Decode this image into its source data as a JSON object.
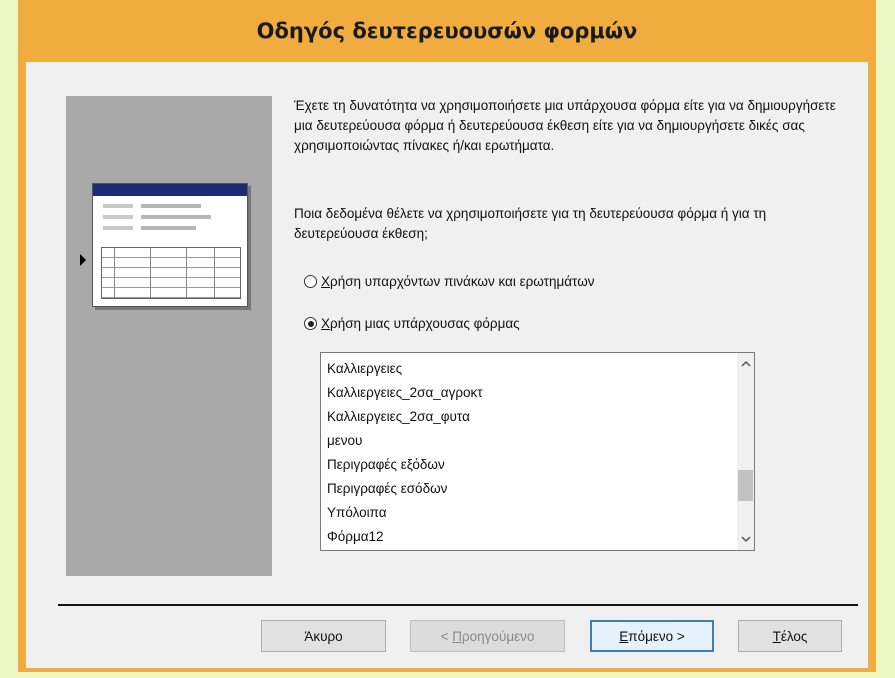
{
  "window": {
    "title": "Οδηγός δευτερευουσών φορμών"
  },
  "intro_text": "Έχετε τη δυνατότητα να χρησιμοποιήσετε μια υπάρχουσα φόρμα είτε για να δημιουργήσετε μια δευτερεύουσα φόρμα ή δευτερεύουσα έκθεση είτε για να δημιουργήσετε δικές σας χρησιμοποιώντας πίνακες ή/και ερωτήματα.",
  "question_text": "Ποια δεδομένα θέλετε να χρησιμοποιήσετε για τη δευτερεύουσα φόρμα ή για τη δευτερεύουσα έκθεση;",
  "options": [
    {
      "label_first": "Χ",
      "label_rest": "ρήση υπαρχόντων πινάκων και ερωτημάτων",
      "checked": false
    },
    {
      "label_first": "Χ",
      "label_rest": "ρήση μιας υπάρχουσας φόρμας",
      "checked": true
    }
  ],
  "form_list": {
    "items": [
      "Καλλιεργειες",
      "Καλλιεργειες_2σα_αγροκτ",
      "Καλλιεργειες_2σα_φυτα",
      "μενου",
      "Περιγραφές εξόδων",
      "Περιγραφές εσόδων",
      "Υπόλοιπα",
      "Φόρμα12"
    ],
    "scroll_up_icon": "chevron-up",
    "scroll_down_icon": "chevron-down"
  },
  "buttons": {
    "cancel": {
      "label": "Άκυρο",
      "enabled": true
    },
    "back": {
      "prefix": "< ",
      "mnemonic": "Π",
      "rest": "ροηγούμενο",
      "enabled": false
    },
    "next": {
      "mnemonic": "Ε",
      "rest": "πόμενο >",
      "enabled": true,
      "default": true
    },
    "finish": {
      "mnemonic": "Τ",
      "rest": "έλος",
      "enabled": true
    }
  },
  "colors": {
    "title_bar": "#f0ac3e",
    "background": "#ecf6c4",
    "graphic_header": "#1c2a7a"
  }
}
